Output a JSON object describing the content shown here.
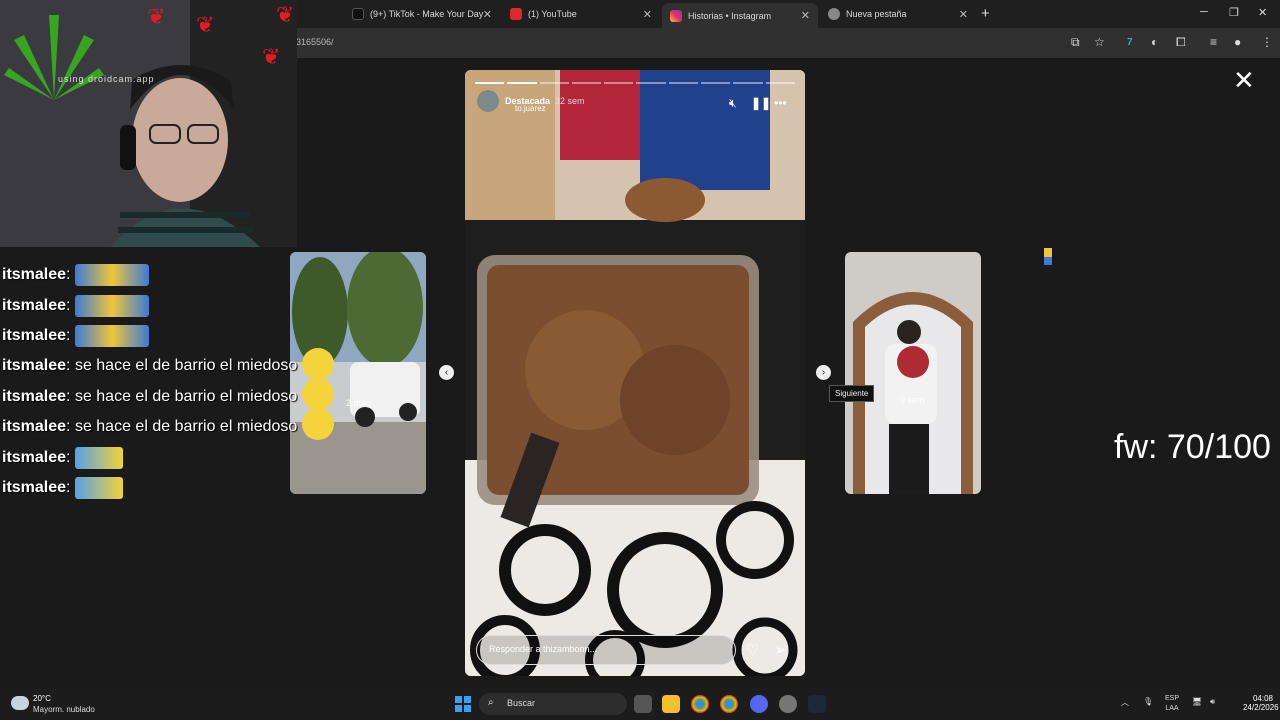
{
  "browser": {
    "tabs": [
      {
        "label": "(9+) TikTok - Make Your Day"
      },
      {
        "label": "(1) YouTube"
      },
      {
        "label": "Historias • Instagram"
      },
      {
        "label": "Nueva pestaña"
      }
    ],
    "url_fragment": "3165506/"
  },
  "webcam": {
    "watermark": "using droidcam.app"
  },
  "story": {
    "author": "Destacada",
    "time": "32 sem",
    "subtitle": "to.juarez",
    "reply_placeholder": "Responder a thizambonn...",
    "close_icon": "close-icon",
    "mute_icon": "mute-icon",
    "pause_icon": "pause-icon",
    "more_icon": "more-icon"
  },
  "next_preview": {
    "tooltip": "Siguiente",
    "weeks": "9 sem"
  },
  "left_preview": {
    "label": "2 días"
  },
  "overlay": {
    "fw": "fw: 70/100"
  },
  "chat": [
    {
      "user": "itsmalee",
      "text": "",
      "emote": true
    },
    {
      "user": "itsmalee",
      "text": "",
      "emote": true
    },
    {
      "user": "itsmalee",
      "text": "",
      "emote": true
    },
    {
      "user": "itsmalee",
      "text": "se hace el de barrio el miedoso",
      "emote": false
    },
    {
      "user": "itsmalee",
      "text": "se hace el de barrio el miedoso",
      "emote": false
    },
    {
      "user": "itsmalee",
      "text": "se hace el de barrio el miedoso",
      "emote": false
    },
    {
      "user": "itsmalee",
      "text": "",
      "emote": true,
      "small": true
    },
    {
      "user": "itsmalee",
      "text": "",
      "emote": true,
      "small": true
    }
  ],
  "taskbar": {
    "temp": "20°C",
    "condition": "Mayorm. nublado",
    "search": "Buscar",
    "lang1": "ESP",
    "lang2": "LAA",
    "time": "04:08",
    "date": "24/2/2026"
  },
  "colors": {
    "accent_blue": "#3aa0f3",
    "butterfly": "#e01b24"
  }
}
